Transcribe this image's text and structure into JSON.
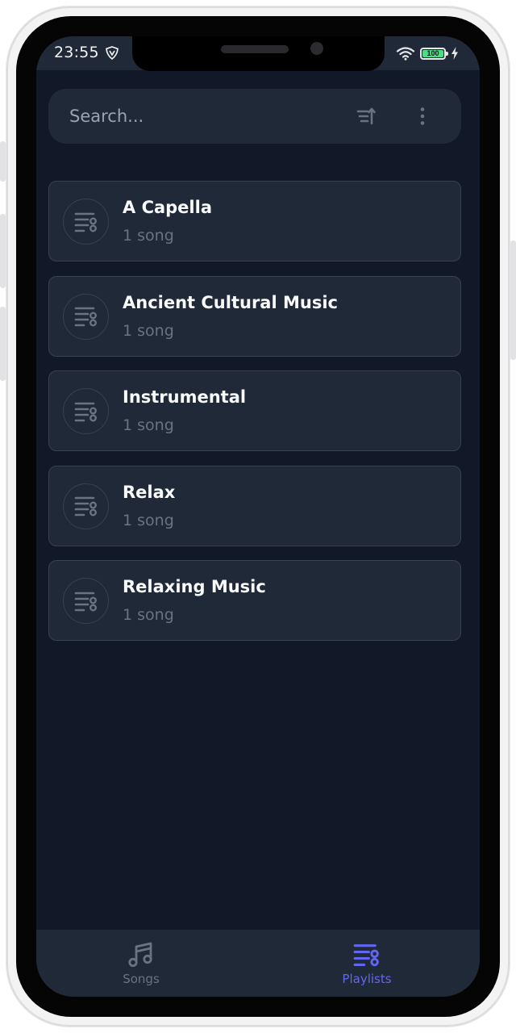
{
  "status_bar": {
    "time": "23:55",
    "battery_level": "100"
  },
  "search": {
    "placeholder": "Search..."
  },
  "playlists": [
    {
      "title": "A Capella",
      "count": "1 song"
    },
    {
      "title": "Ancient Cultural Music",
      "count": "1 song"
    },
    {
      "title": "Instrumental",
      "count": "1 song"
    },
    {
      "title": "Relax",
      "count": "1 song"
    },
    {
      "title": "Relaxing Music",
      "count": "1 song"
    }
  ],
  "bottom_nav": {
    "songs_label": "Songs",
    "playlists_label": "Playlists",
    "active": "playlists"
  },
  "colors": {
    "background": "#111827",
    "surface": "#1f2937",
    "border": "#374151",
    "accent": "#6366f1",
    "muted_text": "#6b7280"
  },
  "icons": {
    "status_vpn": "vpn-shield-icon",
    "status_wifi": "wifi-icon",
    "status_battery": "battery-icon",
    "sort": "sort-icon",
    "more": "more-vertical-icon",
    "playlist": "playlist-music-icon",
    "songs_tab": "music-note-icon",
    "playlists_tab": "playlist-music-icon"
  }
}
